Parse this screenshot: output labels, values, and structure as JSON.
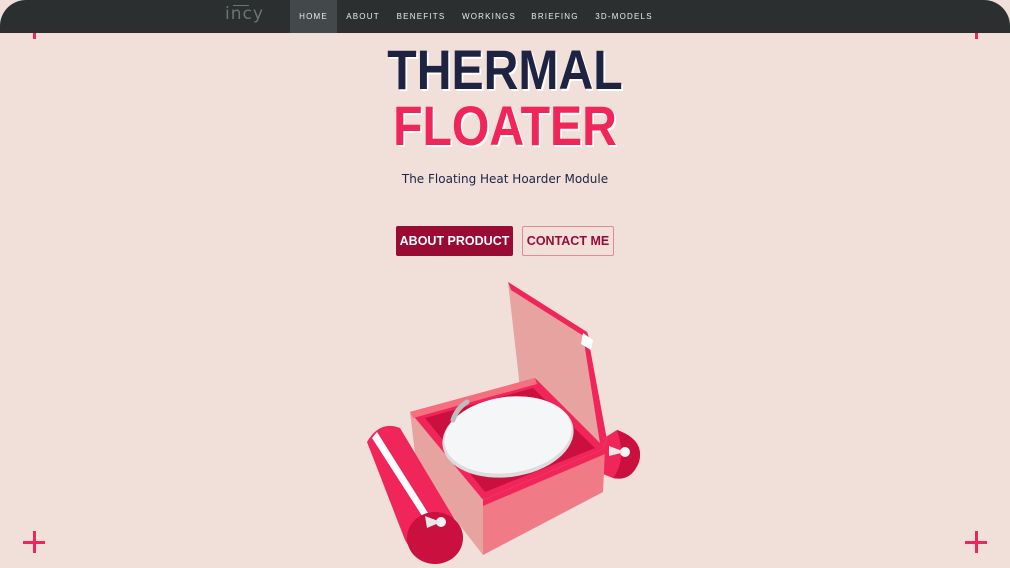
{
  "brand": {
    "logo": "incy"
  },
  "nav": {
    "items": [
      {
        "label": "HOME",
        "active": true
      },
      {
        "label": "ABOUT"
      },
      {
        "label": "BENEFITS"
      },
      {
        "label": "WORKINGS"
      },
      {
        "label": "BRIEFING"
      },
      {
        "label": "3D-MODELS"
      }
    ]
  },
  "hero": {
    "title_line1": "THERMAL",
    "title_line2": "FLOATER",
    "subtitle": "The Floating Heat Hoarder Module",
    "primary_button": "ABOUT PRODUCT",
    "secondary_button": "CONTACT ME"
  },
  "colors": {
    "background": "#f1dfd9",
    "navbar": "#2b2f30",
    "accent": "#f0265a",
    "dark_text": "#1d2340",
    "button": "#9a0b33"
  },
  "icons": [
    "plus-corner-icon",
    "product-illustration"
  ]
}
